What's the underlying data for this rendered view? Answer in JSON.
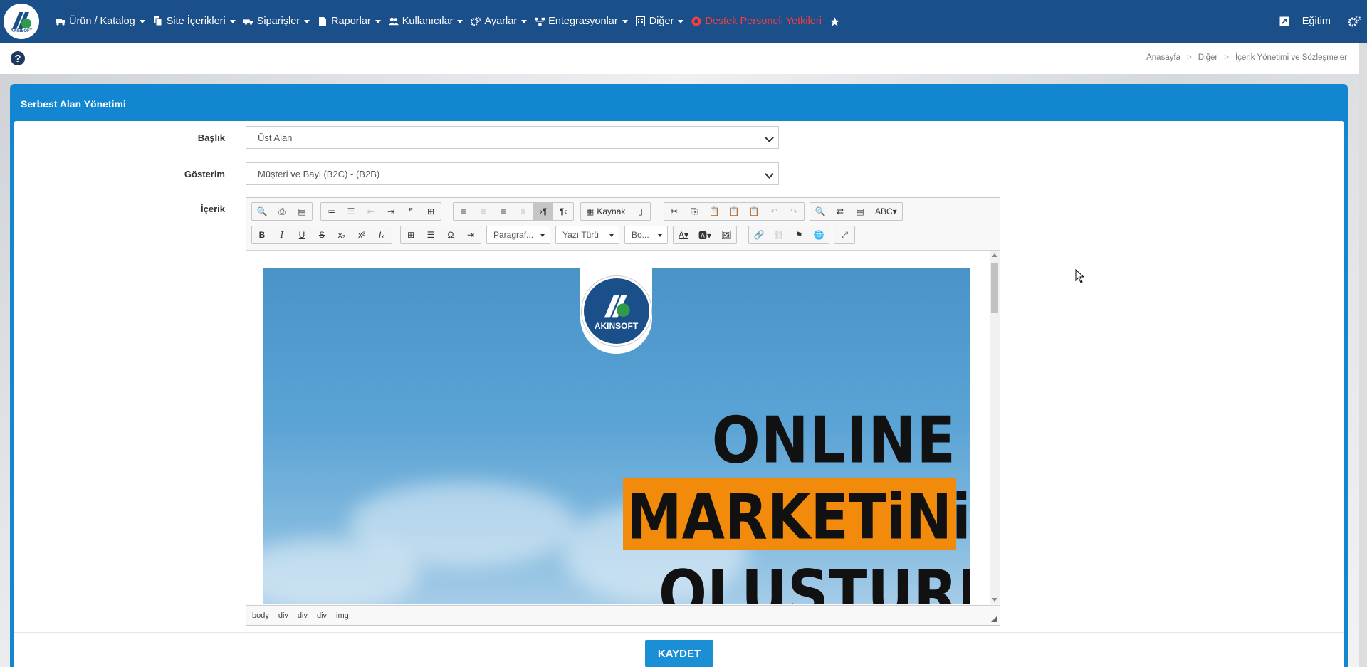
{
  "nav": {
    "logo_text": "AKINSOFT",
    "items": [
      {
        "label": "Ürün / Katalog",
        "icon": "truck-icon"
      },
      {
        "label": "Site İçerikleri",
        "icon": "copy-icon"
      },
      {
        "label": "Siparişler",
        "icon": "shipping-icon"
      },
      {
        "label": "Raporlar",
        "icon": "file-icon"
      },
      {
        "label": "Kullanıcılar",
        "icon": "users-icon"
      },
      {
        "label": "Ayarlar",
        "icon": "cogs-icon"
      },
      {
        "label": "Entegrasyonlar",
        "icon": "sitemap-icon"
      },
      {
        "label": "Diğer",
        "icon": "building-icon"
      },
      {
        "label": "Destek Personeli Yetkileri",
        "icon": "support-icon"
      }
    ],
    "right_label": "Eğitim"
  },
  "breadcrumb": [
    "Anasayfa",
    "Diğer",
    "İçerik Yönetimi ve Sözleşmeler"
  ],
  "help_label": "?",
  "panel": {
    "title": "Serbest Alan Yönetimi"
  },
  "form": {
    "baslik_label": "Başlık",
    "baslik_value": "Üst Alan",
    "gosterim_label": "Gösterim",
    "gosterim_value": "Müşteri ve Bayi (B2C) - (B2B)",
    "icerik_label": "İçerik"
  },
  "editor": {
    "source_label": "Kaynak",
    "format_combo": "Paragraf...",
    "font_combo": "Yazı Türü",
    "size_combo": "Bo...",
    "banner": {
      "logo_text": "AKINSOFT",
      "line1": "ONLINE",
      "line2": "MARKETiNiZi",
      "line3": "OLUŞTURUN"
    },
    "path": [
      "body",
      "div",
      "div",
      "div",
      "img"
    ]
  },
  "save_label": "KAYDET",
  "colors": {
    "navbar": "#1b4f8a",
    "panel": "#1286d0",
    "save": "#1a8fd6",
    "highlight": "#f28b0c",
    "support": "#ff3b3b"
  }
}
